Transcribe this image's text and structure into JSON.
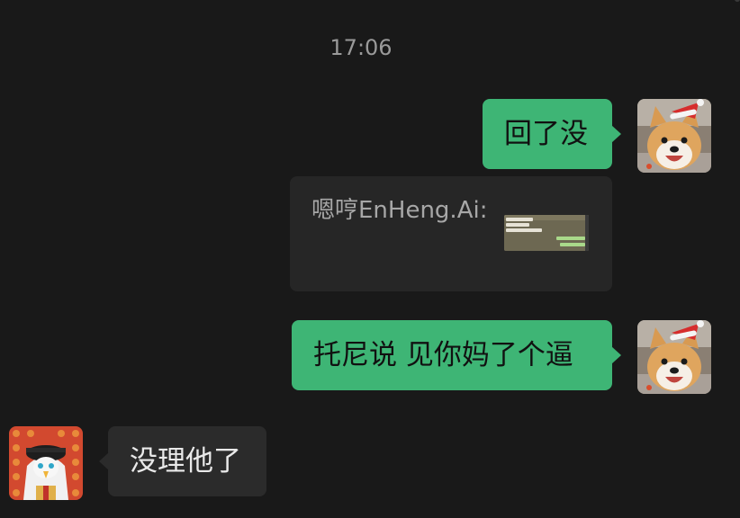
{
  "chat": {
    "timestamp": "17:06",
    "messages": [
      {
        "direction": "outgoing",
        "sender": "me",
        "text": "回了没"
      },
      {
        "direction": "outgoing",
        "type": "quoted-screenshot",
        "quote_sender": "嗯哼EnHeng.Ai:"
      },
      {
        "direction": "outgoing",
        "sender": "me",
        "text": "托尼说  见你妈了个逼"
      },
      {
        "direction": "incoming",
        "sender": "contact",
        "text": "没理他了"
      }
    ]
  },
  "avatars": {
    "me": {
      "icon": "shiba-dog-santa-hat-icon"
    },
    "contact": {
      "icon": "cartoon-bird-headscarf-icon"
    }
  },
  "colors": {
    "background": "#191919",
    "outgoing_bubble": "#3eb575",
    "incoming_bubble": "#2b2b2b",
    "quote_card": "#262626",
    "timestamp": "#9a9a9a"
  }
}
